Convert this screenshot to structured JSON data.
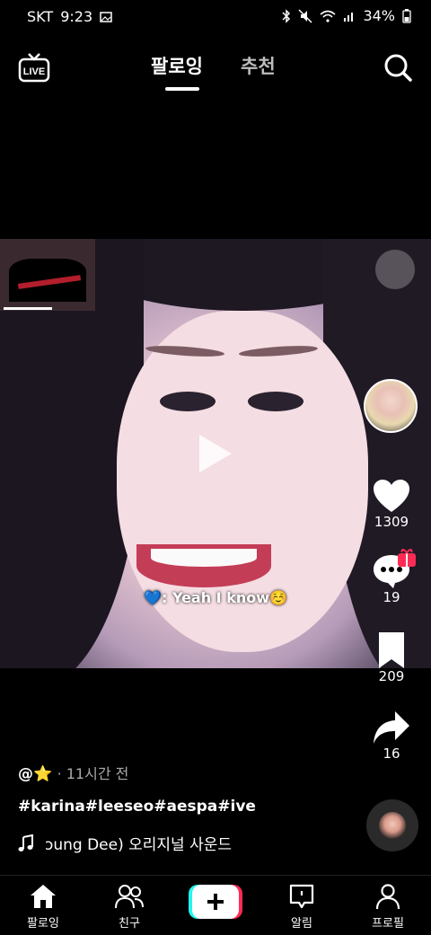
{
  "status_bar": {
    "carrier": "SKT",
    "time": "9:23",
    "battery": "34%"
  },
  "top": {
    "tab_following": "팔로잉",
    "tab_recommend": "추천",
    "live_label": "LIVE"
  },
  "video": {
    "caption": "💙: Yeah I know☺️"
  },
  "actions": {
    "likes": "1309",
    "comments": "19",
    "saves": "209",
    "shares": "16"
  },
  "post": {
    "handle": "@⭐",
    "time": "· 11시간 전",
    "hashtags": "#karina#leeseo#aespa#ive",
    "sound": "ɔung Dee)    오리지널 사운드"
  },
  "nav": {
    "home": "팔로잉",
    "friends": "친구",
    "inbox": "알림",
    "profile": "프로필"
  },
  "colors": {
    "accent_cyan": "#25f4ee",
    "accent_red": "#fe2c55",
    "background": "#000000"
  }
}
